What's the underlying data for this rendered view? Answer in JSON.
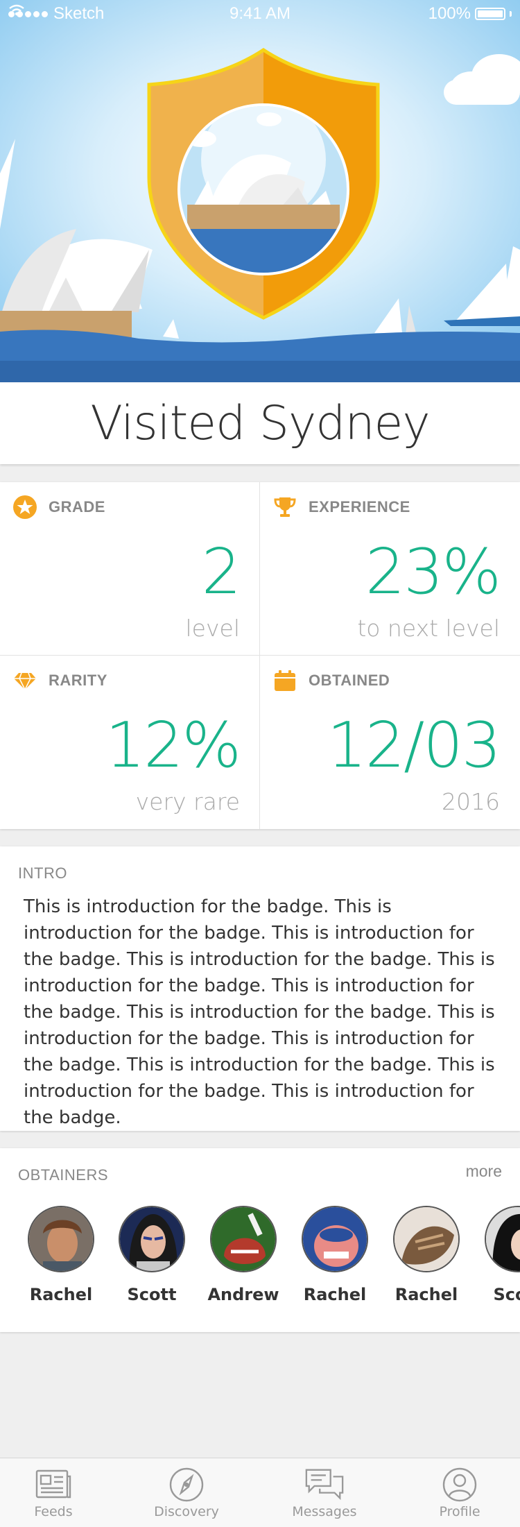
{
  "status_bar": {
    "carrier": "Sketch",
    "time": "9:41 AM",
    "battery": "100%"
  },
  "badge": {
    "title": "Visited Sydney",
    "shield_colors": [
      "#f0b24c",
      "#f29c0a"
    ],
    "shield_border": "#f5d31c"
  },
  "stats": [
    {
      "label": "GRADE",
      "value": "2",
      "sub": "level",
      "icon": "star-icon"
    },
    {
      "label": "EXPERIENCE",
      "value": "23%",
      "sub": "to next level",
      "icon": "trophy-icon"
    },
    {
      "label": "RARITY",
      "value": "12%",
      "sub": "very rare",
      "icon": "diamond-icon"
    },
    {
      "label": "OBTAINED",
      "value": "12/03",
      "sub": "2016",
      "icon": "calendar-icon"
    }
  ],
  "intro": {
    "label": "INTRO",
    "text": "This is introduction for the badge. This is introduction for the badge. This is introduction for the badge. This is introduction for the badge. This is introduction for the badge. This is introduction for the badge. This is introduction for the badge. This is introduction for the badge. This is introduction for the badge. This is introduction for the badge. This is introduction for the badge. This is introduction for the badge."
  },
  "obtainers": {
    "label": "OBTAINERS",
    "more": "more",
    "people": [
      {
        "name": "Rachel"
      },
      {
        "name": "Scott"
      },
      {
        "name": "Andrew"
      },
      {
        "name": "Rachel"
      },
      {
        "name": "Rachel"
      },
      {
        "name": "Scott"
      }
    ]
  },
  "tabbar": [
    {
      "label": "Feeds",
      "icon": "feeds-icon"
    },
    {
      "label": "Discovery",
      "icon": "compass-icon"
    },
    {
      "label": "Messages",
      "icon": "messages-icon"
    },
    {
      "label": "Profile",
      "icon": "profile-icon"
    }
  ],
  "colors": {
    "accent_green": "#19b38a",
    "icon_orange": "#f5a623",
    "sky": "#9fd3f2",
    "sea": "#3876be"
  }
}
